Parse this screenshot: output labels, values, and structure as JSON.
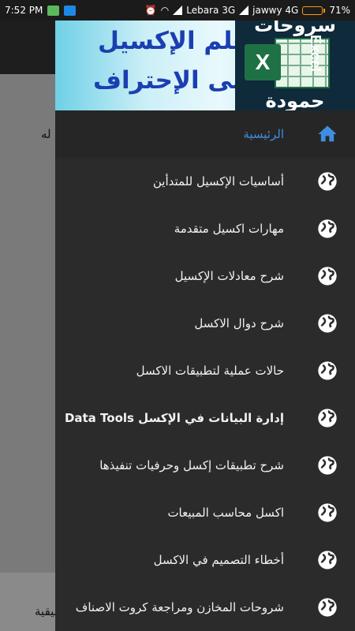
{
  "status_bar": {
    "time": "7:52 PM",
    "carrier1": "Lebara 3G",
    "carrier2": "jawwy 4G",
    "battery_percent": "71%",
    "battery_level": 0.71
  },
  "background": {
    "text_top": "له",
    "text_bottom": "بيقية"
  },
  "banner": {
    "line1": "تعلم الإكسيل",
    "line2": "حتى الإحتراف",
    "logo_top": "سروحات",
    "logo_bottom": "حمودة",
    "logo_word": "Excel",
    "logo_letter": "X"
  },
  "menu": {
    "items": [
      {
        "label": "الرئيسية",
        "icon": "home-icon"
      },
      {
        "label": "أساسيات الإكسيل للمتدأين",
        "icon": "globe-icon"
      },
      {
        "label": "مهارات اكسيل متقدمة",
        "icon": "globe-icon"
      },
      {
        "label": "شرح معادلات الإكسيل",
        "icon": "globe-icon"
      },
      {
        "label": "شرح دوال الاكسل",
        "icon": "globe-icon"
      },
      {
        "label": "حالات عملية لتطبيقات الاكسل",
        "icon": "globe-icon"
      },
      {
        "label": "إدارة البيانات في الإكسل Data Tools",
        "icon": "globe-icon"
      },
      {
        "label": "شرح تطبيقات إكسل وحرفيات تنفيذها",
        "icon": "globe-icon"
      },
      {
        "label": "اكسل محاسب المبيعات",
        "icon": "globe-icon"
      },
      {
        "label": "أخطاء التصميم في الاكسل",
        "icon": "globe-icon"
      },
      {
        "label": "شروحات المخازن ومراجعة كروت الاصناف",
        "icon": "globe-icon"
      }
    ]
  },
  "colors": {
    "drawer_bg": "#2b2b2b",
    "accent": "#3f8ee0",
    "status_bg": "#1b1b1b",
    "battery": "#f39c12"
  }
}
